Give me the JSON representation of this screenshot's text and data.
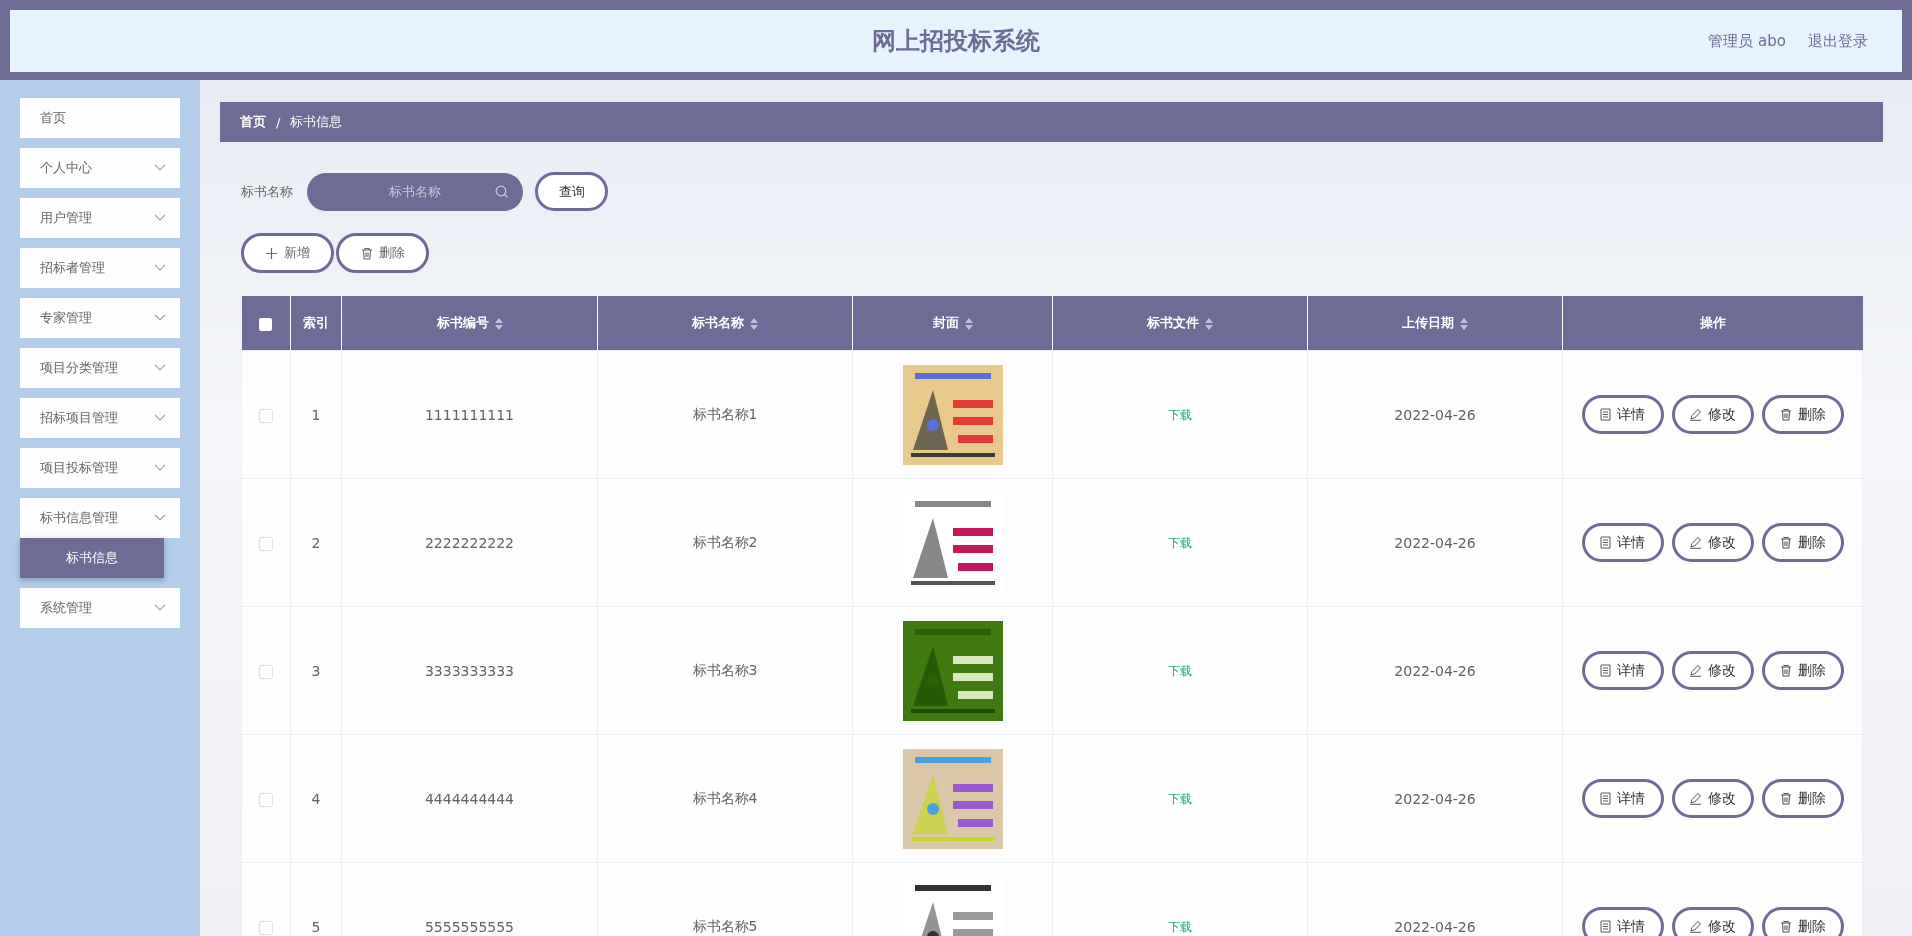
{
  "header": {
    "title": "网上招投标系统",
    "user": "管理员 abo",
    "logout": "退出登录"
  },
  "sidebar": {
    "items": [
      {
        "label": "首页",
        "kind": "link"
      },
      {
        "label": "个人中心",
        "kind": "submenu"
      },
      {
        "label": "用户管理",
        "kind": "submenu"
      },
      {
        "label": "招标者管理",
        "kind": "submenu"
      },
      {
        "label": "专家管理",
        "kind": "submenu"
      },
      {
        "label": "项目分类管理",
        "kind": "submenu"
      },
      {
        "label": "招标项目管理",
        "kind": "submenu"
      },
      {
        "label": "项目投标管理",
        "kind": "submenu"
      },
      {
        "label": "标书信息管理",
        "kind": "submenu",
        "children": [
          {
            "label": "标书信息",
            "selected": true
          }
        ]
      },
      {
        "label": "系统管理",
        "kind": "submenu"
      }
    ]
  },
  "breadcrumb": [
    "首页",
    "/",
    "标书信息"
  ],
  "search": {
    "label": "标书名称",
    "placeholder": "标书名称",
    "button": "查询"
  },
  "toolbar": [
    {
      "label": "新增",
      "kind": "add"
    },
    {
      "label": "删除",
      "kind": "delete"
    }
  ],
  "table": {
    "select_all_checked": false,
    "columns": [
      {
        "label": "索引",
        "sortable": false
      },
      {
        "label": "标书编号",
        "sortable": true
      },
      {
        "label": "标书名称",
        "sortable": true
      },
      {
        "label": "封面",
        "sortable": true
      },
      {
        "label": "标书文件",
        "sortable": true
      },
      {
        "label": "上传日期",
        "sortable": true
      },
      {
        "label": "操作",
        "sortable": false
      }
    ],
    "rows": [
      {
        "checked": false,
        "index": "1",
        "code": "1111111111",
        "name": "标书名称1",
        "file": "下载",
        "date": "2022-04-26",
        "actions": [
          {
            "label": "详情",
            "kind": "detail"
          },
          {
            "label": "修改",
            "kind": "edit"
          },
          {
            "label": "删除",
            "kind": "delete"
          }
        ]
      },
      {
        "checked": false,
        "index": "2",
        "code": "2222222222",
        "name": "标书名称2",
        "file": "下载",
        "date": "2022-04-26",
        "actions": [
          {
            "label": "详情",
            "kind": "detail"
          },
          {
            "label": "修改",
            "kind": "edit"
          },
          {
            "label": "删除",
            "kind": "delete"
          }
        ]
      },
      {
        "checked": false,
        "index": "3",
        "code": "3333333333",
        "name": "标书名称3",
        "file": "下载",
        "date": "2022-04-26",
        "actions": [
          {
            "label": "详情",
            "kind": "detail"
          },
          {
            "label": "修改",
            "kind": "edit"
          },
          {
            "label": "删除",
            "kind": "delete"
          }
        ]
      },
      {
        "checked": false,
        "index": "4",
        "code": "4444444444",
        "name": "标书名称4",
        "file": "下载",
        "date": "2022-04-26",
        "actions": [
          {
            "label": "详情",
            "kind": "detail"
          },
          {
            "label": "修改",
            "kind": "edit"
          },
          {
            "label": "删除",
            "kind": "delete"
          }
        ]
      },
      {
        "checked": false,
        "index": "5",
        "code": "5555555555",
        "name": "标书名称5",
        "file": "下载",
        "date": "2022-04-26",
        "actions": [
          {
            "label": "详情",
            "kind": "detail"
          },
          {
            "label": "修改",
            "kind": "edit"
          },
          {
            "label": "删除",
            "kind": "delete"
          }
        ]
      }
    ]
  }
}
